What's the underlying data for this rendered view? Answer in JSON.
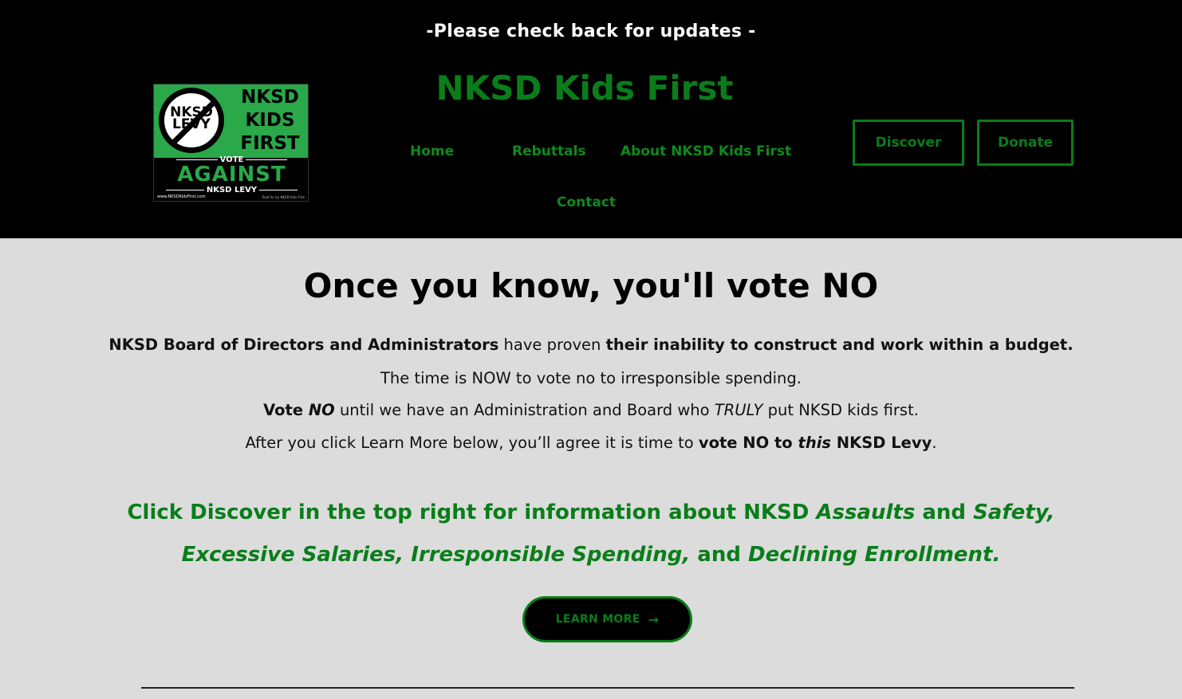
{
  "announcement": "-Please check back for updates -",
  "logo": {
    "circle_text_1": "NKSD",
    "circle_text_2": "LEVY",
    "words": [
      "NKSD",
      "KIDS",
      "FIRST"
    ],
    "vote": "VOTE",
    "against": "AGAINST",
    "levy": "NKSD LEVY",
    "url": "www.NKSDKidsFirst.com",
    "paid": "Paid for by NKSD Kids First"
  },
  "site_title": "NKSD Kids First",
  "nav": {
    "home": "Home",
    "rebuttals": "Rebuttals",
    "about": "About NKSD Kids First",
    "contact": "Contact"
  },
  "header_buttons": {
    "discover": "Discover",
    "donate": "Donate"
  },
  "main": {
    "headline": "Once you know, you'll vote NO",
    "line1": {
      "a": "NKSD Board of Directors and Administrators",
      "b": " have proven ",
      "c": "their inability to construct and work within a budget."
    },
    "line2": "The time is NOW to vote no to irresponsible spending.",
    "line3": {
      "a": "Vote ",
      "b": "NO",
      "c": " until we have an Administration and Board who ",
      "d": "TRULY",
      "e": " put NKSD kids first."
    },
    "line4": {
      "a": "After you click Learn More below, you’ll agree it is time to ",
      "b": "vote NO to ",
      "c": "this",
      "d": " NKSD Levy",
      "e": "."
    },
    "green1": {
      "a": "Click Discover in the top right for information about NKSD ",
      "b": "Assaults",
      "c": " and ",
      "d": "Safety,"
    },
    "green2": {
      "a": "Excessive Salaries, Irresponsible Spending,",
      "b": " and ",
      "c": "Declining Enrollment."
    },
    "learn_more": "LEARN MORE"
  },
  "colors": {
    "header_bg": "#000000",
    "page_bg": "#dcdcdc",
    "accent_green": "#0a7d1a",
    "logo_green": "#2aa84a"
  }
}
